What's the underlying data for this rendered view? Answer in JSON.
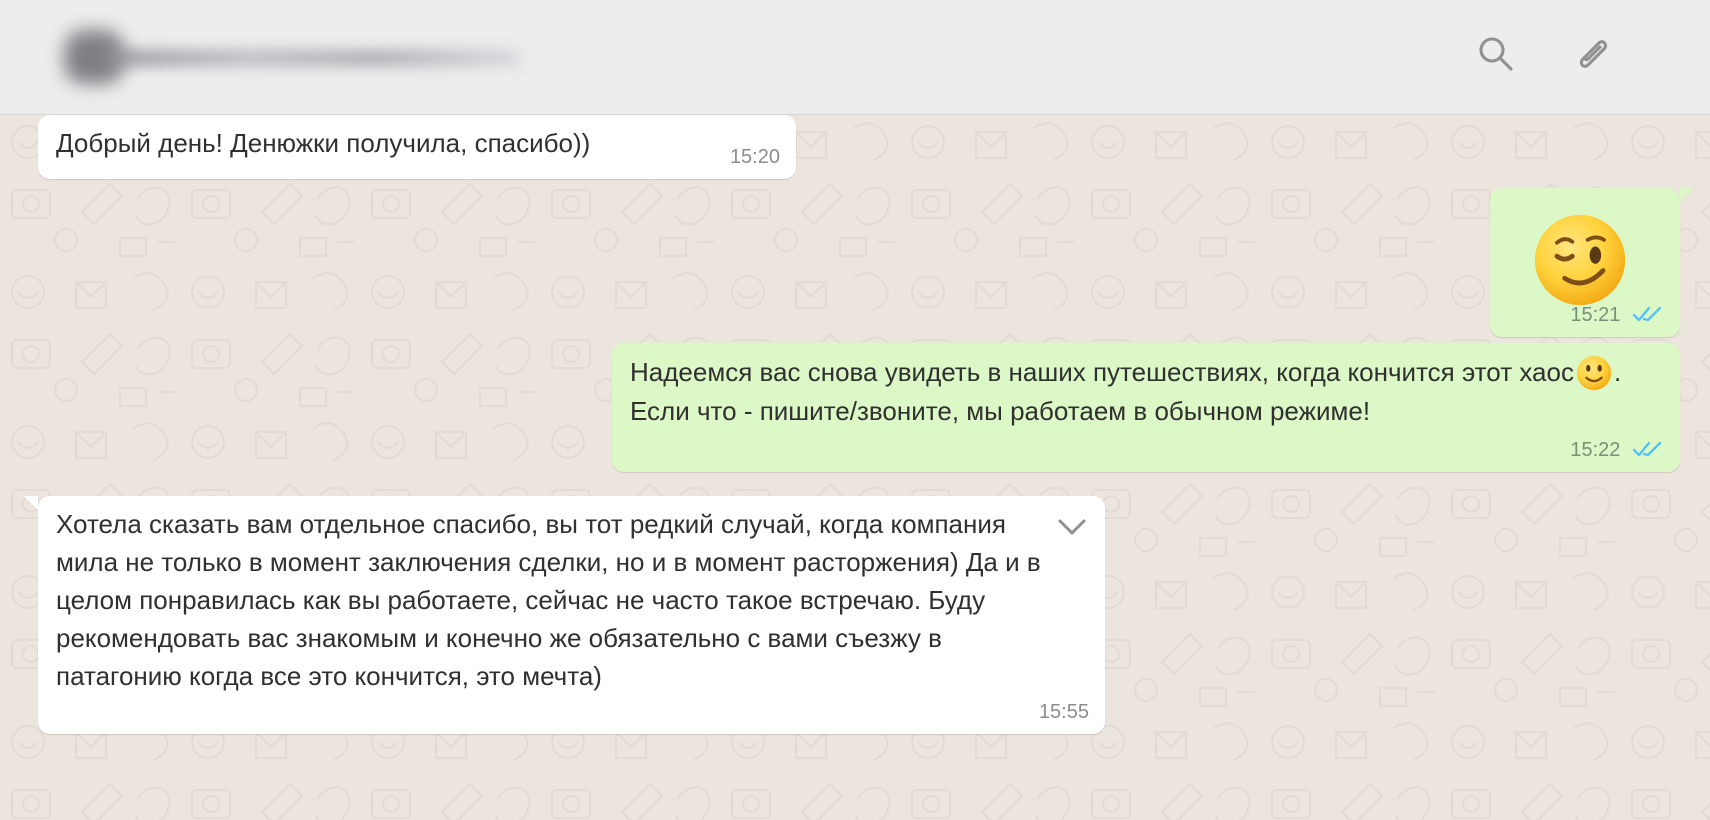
{
  "header": {
    "search_icon": "search-icon",
    "attach_icon": "paperclip-icon"
  },
  "messages": [
    {
      "direction": "incoming",
      "text": "Добрый день! Денюжки получила, спасибо))",
      "time": "15:20"
    },
    {
      "direction": "outgoing",
      "emoji": "winking-face-emoji",
      "time": "15:21",
      "status_icon": "double-check-icon"
    },
    {
      "direction": "outgoing",
      "text_before": "Надеемся вас снова увидеть в наших путешествиях, когда кончится этот хаос",
      "emoji": "smiling-face-emoji",
      "text_after": ". Если что - пишите/звоните, мы работаем в обычном режиме!",
      "time": "15:22",
      "status_icon": "double-check-icon"
    },
    {
      "direction": "incoming",
      "text": "Хотела сказать вам отдельное спасибо, вы тот редкий случай, когда компания мила не только в момент заключения сделки, но и в момент расторжения) Да и в целом понравилась как вы работаете, сейчас не часто такое встречаю. Буду рекомендовать вас знакомым и конечно же обязательно с вами съезжу в патагонию когда все это кончится, это мечта)",
      "time": "15:55",
      "menu_icon": "chevron-down-icon"
    }
  ],
  "colors": {
    "chat_background": "#ece5dd",
    "header_background": "#ededed",
    "incoming_bubble": "#ffffff",
    "outgoing_bubble": "#dcf8c6",
    "read_tick": "#4fc3f7"
  }
}
